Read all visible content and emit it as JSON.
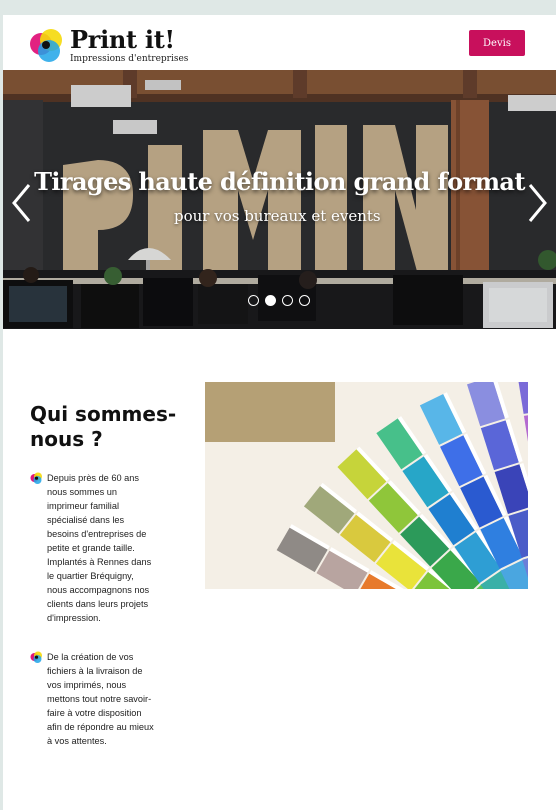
{
  "header": {
    "logo_title": "Print it!",
    "logo_subtitle": "Impressions d'entreprises",
    "devis_label": "Devis"
  },
  "hero": {
    "title": "Tirages haute définition grand format",
    "subtitle": "pour vos bureaux et events",
    "slide_count": 4,
    "active_slide": 2,
    "prev_icon": "chevron-left-icon",
    "next_icon": "chevron-right-icon"
  },
  "about": {
    "title": "Qui sommes-nous ?",
    "bullets": [
      "Depuis près de 60 ans nous sommes un imprimeur familial spécialisé dans les besoins d'entreprises de petite et grande taille. Implantés à Rennes dans le quartier Bréquigny, nous accompagnons nos clients dans leurs projets d'impression.",
      "De la création de vos fichiers à la livraison de vos imprimés, nous mettons tout notre savoir-faire à votre disposition afin de répondre au mieux à vos attentes."
    ],
    "bullet_icon": "cmyk-dots-icon"
  },
  "colors": {
    "accent": "#c8105c",
    "cyan": "#1ea5e8",
    "magenta": "#e0157a",
    "yellow": "#f5d90a",
    "background": "#dfe8e6"
  }
}
